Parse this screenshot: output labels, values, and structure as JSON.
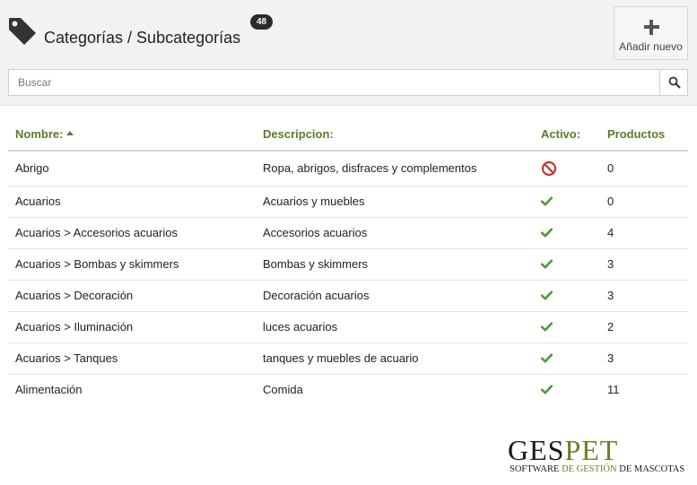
{
  "header": {
    "title": "Categorías / Subcategorías",
    "count": "48",
    "add_label": "Añadir nuevo"
  },
  "search": {
    "placeholder": "Buscar",
    "value": ""
  },
  "table": {
    "columns": [
      "Nombre:",
      "Descripcion:",
      "Activo:",
      "Productos"
    ],
    "sorted_column": "Nombre:",
    "sort_direction": "ascending",
    "rows": [
      {
        "name": "Abrigo",
        "description": "Ropa, abrigos, disfraces y complementos",
        "active": false,
        "products": "0"
      },
      {
        "name": "Acuarios",
        "description": "Acuarios y muebles",
        "active": true,
        "products": "0"
      },
      {
        "name": "Acuarios > Accesorios acuarios",
        "description": "Accesorios acuarios",
        "active": true,
        "products": "4"
      },
      {
        "name": "Acuarios > Bombas y skimmers",
        "description": "Bombas y skimmers",
        "active": true,
        "products": "3"
      },
      {
        "name": "Acuarios > Decoración",
        "description": "Decoración acuarios",
        "active": true,
        "products": "3"
      },
      {
        "name": "Acuarios > Iluminación",
        "description": "luces acuarios",
        "active": true,
        "products": "2"
      },
      {
        "name": "Acuarios > Tanques",
        "description": "tanques y muebles de acuario",
        "active": true,
        "products": "3"
      },
      {
        "name": "Alimentación",
        "description": "Comida",
        "active": true,
        "products": "11"
      }
    ]
  },
  "logo": {
    "word_part1": "GES",
    "word_part2": "PET",
    "tagline_part1": "SOFTWARE ",
    "tagline_part2": "DE GESTIÓN ",
    "tagline_part3": "DE MASCOTAS"
  },
  "colors": {
    "accent_green": "#5b7a2a",
    "check_green": "#4e9a3a",
    "inactive_red": "#c0392b",
    "badge_dark": "#2b2b2b",
    "header_bg": "#f2f2f2"
  },
  "icons": {
    "title": "tag-icon",
    "add": "plus-icon",
    "search": "search-icon",
    "active": "check-icon",
    "inactive": "ban-icon",
    "sort": "sort-asc-icon"
  }
}
